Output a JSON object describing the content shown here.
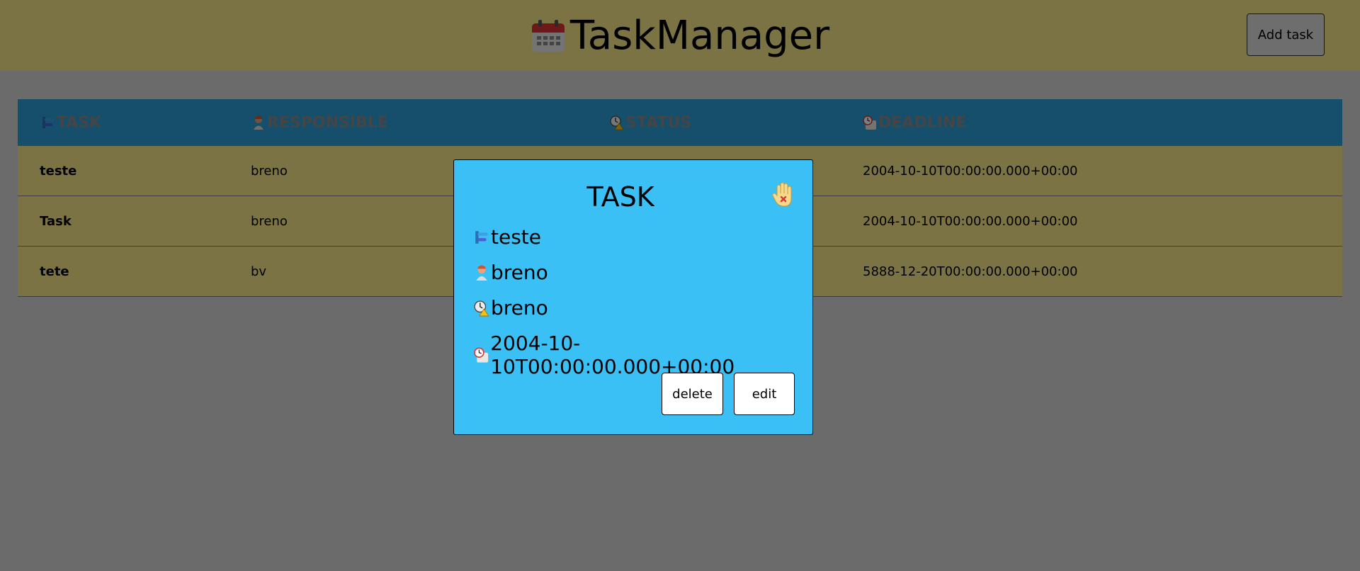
{
  "header": {
    "title": "TaskManager",
    "add_task_label": "Add task"
  },
  "table": {
    "columns": [
      {
        "label": "TASK",
        "icon": "task-icon"
      },
      {
        "label": "RESPONSIBLE",
        "icon": "person-icon"
      },
      {
        "label": "STATUS",
        "icon": "status-icon"
      },
      {
        "label": "DEADLINE",
        "icon": "calendar-icon"
      }
    ],
    "rows": [
      {
        "task": "teste",
        "responsible": "breno",
        "deadline": "2004-10-10T00:00:00.000+00:00"
      },
      {
        "task": "Task",
        "responsible": "breno",
        "deadline": "2004-10-10T00:00:00.000+00:00"
      },
      {
        "task": "tete",
        "responsible": "bv",
        "deadline": "5888-12-20T00:00:00.000+00:00"
      }
    ]
  },
  "modal": {
    "title": "TASK",
    "task": "teste",
    "responsible": "breno",
    "status": "breno",
    "deadline": "2004-10-10T00:00:00.000+00:00",
    "delete_label": "delete",
    "edit_label": "edit"
  },
  "colors": {
    "header_bg": "#f6e788",
    "table_header_bg": "#2b9fd8",
    "modal_bg": "#3bc0f5"
  }
}
